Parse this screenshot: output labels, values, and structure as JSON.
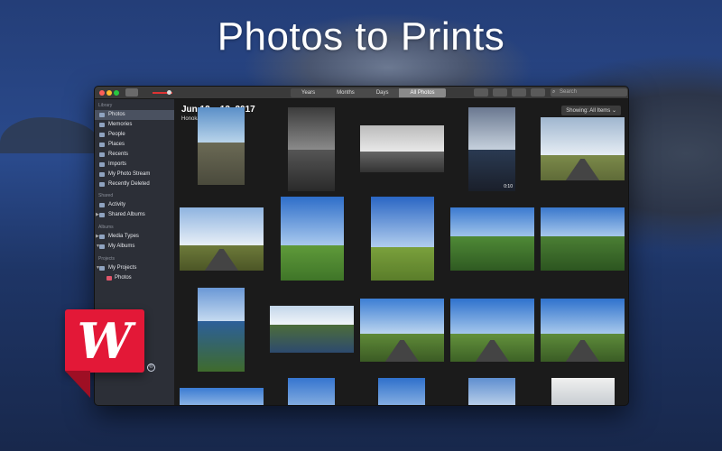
{
  "banner": {
    "title": "Photos to Prints"
  },
  "toolbar": {
    "segments": [
      "Years",
      "Months",
      "Days",
      "All Photos"
    ],
    "selected_segment": "All Photos",
    "search_placeholder": "Search"
  },
  "sidebar": {
    "library_label": "Library",
    "library_items": [
      "Photos",
      "Memories",
      "People",
      "Places",
      "Recents",
      "Imports",
      "My Photo Stream",
      "Recently Deleted"
    ],
    "shared_label": "Shared",
    "shared_items": [
      "Activity",
      "Shared Albums"
    ],
    "albums_label": "Albums",
    "album_items": [
      "Media Types",
      "My Albums"
    ],
    "projects_label": "Projects",
    "project_items": [
      "My Projects",
      "Photos"
    ]
  },
  "main": {
    "date": "Jun 12 – 13, 2017",
    "location": "Honokaa",
    "showing": "Showing: All Items ⌄",
    "video_duration": "0:10"
  },
  "logo": {
    "letter": "W",
    "brand_color": "#e31837",
    "registered": "®"
  }
}
